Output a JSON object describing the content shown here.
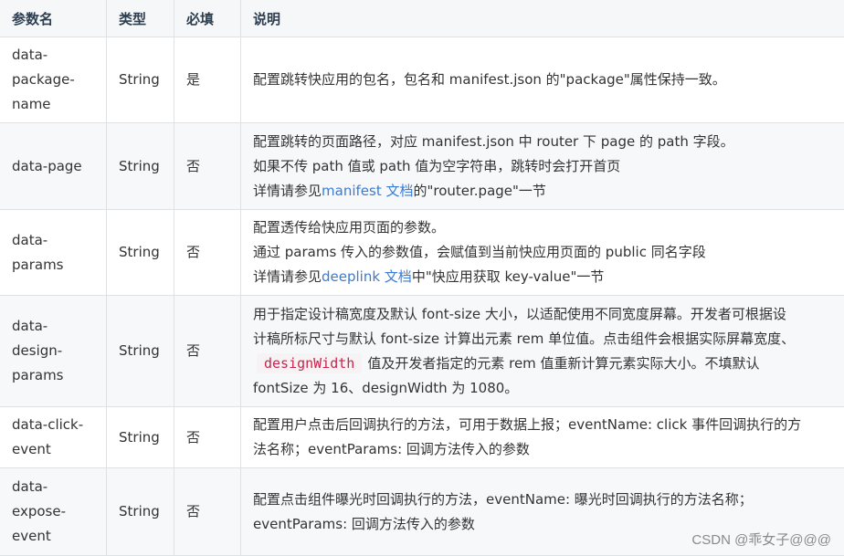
{
  "headers": {
    "name": "参数名",
    "type": "类型",
    "required": "必填",
    "desc": "说明"
  },
  "rows": [
    {
      "name_lines": [
        "data-",
        "package-",
        "name"
      ],
      "type": "String",
      "required": "是",
      "desc": {
        "l1": "配置跳转快应用的包名，包名和 manifest.json 的\"package\"属性保持一致。"
      }
    },
    {
      "name": "data-page",
      "type": "String",
      "required": "否",
      "desc": {
        "l1": "配置跳转的页面路径，对应 manifest.json 中 router 下 page 的 path 字段。",
        "l2": "如果不传 path 值或 path 值为空字符串，跳转时会打开首页",
        "l3_pre": "详情请参见",
        "l3_link": "manifest 文档",
        "l3_post": "的\"router.page\"一节"
      }
    },
    {
      "name_lines": [
        "data-",
        "params"
      ],
      "type": "String",
      "required": "否",
      "desc": {
        "l1": "配置透传给快应用页面的参数。",
        "l2": "通过 params 传入的参数值，会赋值到当前快应用页面的 public 同名字段",
        "l3_pre": "详情请参见",
        "l3_link": "deeplink 文档",
        "l3_post": "中\"快应用获取 key-value\"一节"
      }
    },
    {
      "name_lines": [
        "data-",
        "design-",
        "params"
      ],
      "type": "String",
      "required": "否",
      "desc": {
        "l1": "用于指定设计稿宽度及默认 font-size 大小，以适配使用不同宽度屏幕。开发者可根据设",
        "l2": "计稿所标尺寸与默认 font-size 计算出元素 rem 单位值。点击组件会根据实际屏幕宽度、",
        "l3_code": "designWidth",
        "l3_post": "值及开发者指定的元素 rem 值重新计算元素实际大小。不填默认",
        "l4": "fontSize 为 16、designWidth 为 1080。"
      }
    },
    {
      "name_lines": [
        "data-click-",
        "event"
      ],
      "type": "String",
      "required": "否",
      "desc": {
        "l1": "配置用户点击后回调执行的方法，可用于数据上报；eventName: click 事件回调执行的方",
        "l2": "法名称；eventParams: 回调方法传入的参数"
      }
    },
    {
      "name_lines": [
        "data-",
        "expose-",
        "event"
      ],
      "type": "String",
      "required": "否",
      "desc": {
        "l1": "配置点击组件曝光时回调执行的方法，eventName: 曝光时回调执行的方法名称；",
        "l2": "eventParams: 回调方法传入的参数"
      }
    }
  ],
  "watermark": "CSDN @乖女子@@@"
}
